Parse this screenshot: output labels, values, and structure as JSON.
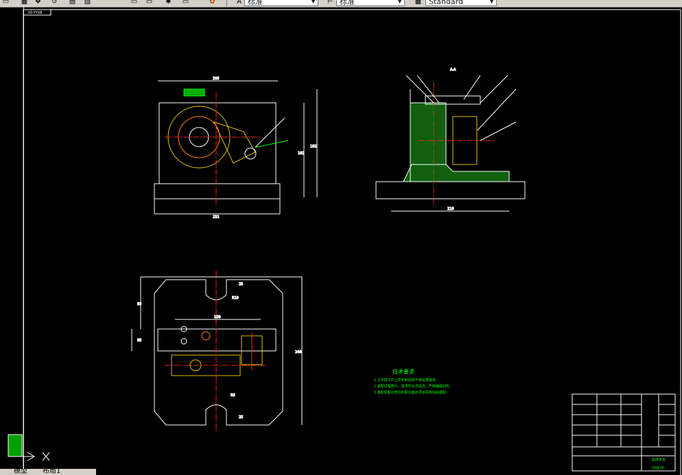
{
  "toolbar": {
    "icons": [
      "document-icon",
      "grid-icon",
      "move-icon",
      "undo-icon",
      "table-icon",
      "zoom-icon",
      "star-icon",
      "layer-icon",
      "layer-icon",
      "layer-icon",
      "palette-icon"
    ],
    "combo_text_style": "标准",
    "combo_dim_style": "标准",
    "combo_table_style": "Standard"
  },
  "drawing": {
    "sheet_label": "00-YYXB",
    "section_label": "A-A",
    "tech_title": "技术要求",
    "tech_lines": [
      "1.工作前工件上的毛刺清除干净后再装夹。",
      "2.装配过程部分，各零件必须清洁，严禁磕碰划伤。",
      "3.装配前配合部位的配合面必须涂润滑油后装配。"
    ],
    "dims_top_view": [
      "205",
      "182",
      "162",
      "232"
    ],
    "dims_side_view": [
      "218"
    ],
    "dims_plan_view": [
      "138",
      "248",
      "95",
      "83",
      "25",
      "R10",
      "R9",
      "25"
    ],
    "title_block_code": "XDJJ-00",
    "title_block_name": "钻床夹具"
  },
  "status": {
    "tab_model": "模型",
    "tab_layout": "布局1"
  },
  "colors": {
    "background": "#000000",
    "line_white": "#ffffff",
    "centerline_red": "#ff2020",
    "hatch_green": "#00c000",
    "text_green": "#00ff00",
    "part_yellow": "#e0c000",
    "part_orange": "#ff8000",
    "dim_cyan": "#00ffff"
  }
}
